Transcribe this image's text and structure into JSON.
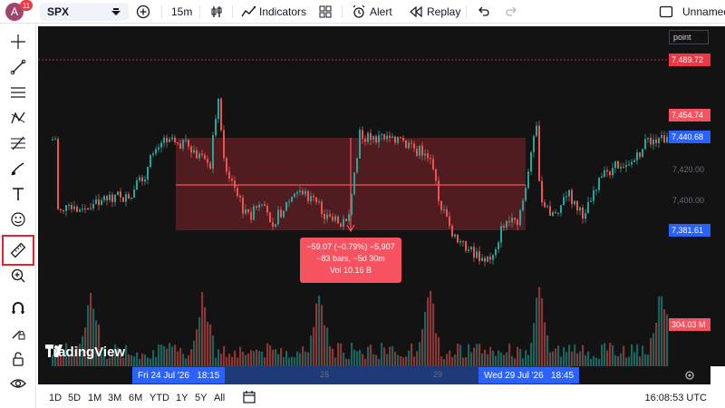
{
  "header": {
    "avatar_letter": "A",
    "notification_count": "11",
    "symbol": "SPX",
    "interval": "15m",
    "indicators_label": "Indicators",
    "alert_label": "Alert",
    "replay_label": "Replay",
    "layout_name": "Unnamed"
  },
  "left_toolbar": {
    "items": [
      "crosshair-icon",
      "trend-line-icon",
      "horizontal-lines-icon",
      "pattern-icon",
      "fib-icon",
      "brush-icon",
      "text-icon",
      "emoji-icon",
      "ruler-icon",
      "zoom-in-icon",
      "magnet-icon",
      "lock-drawing-icon",
      "unlock-icon",
      "eye-icon"
    ],
    "selected": "ruler-icon"
  },
  "chart": {
    "scale_mode": "point",
    "watermark": "TradingView",
    "price_labels": {
      "high": "7,489.72",
      "upper": "7,454.74",
      "current": "7,440.68",
      "lower": "7,381.61",
      "volume": "304.03 M"
    },
    "price_ticks": [
      "7,420.00",
      "7,400.00"
    ],
    "measure": {
      "line1": "−59.07 (−0.79%) −5,907",
      "line2": "−83 bars, −5d 30m",
      "line3": "Vol 10.16 B"
    },
    "time_ticks": [
      "28",
      "29"
    ],
    "time_start": "Fri 24 Jul '26   18:15",
    "time_end": "Wed 29 Jul '26   18:45",
    "colors": {
      "background": "#131313",
      "up": "#26a69a",
      "down": "#ef5350",
      "measure_fill": "rgba(242,54,69,0.28)",
      "measure_popup": "#f7525f",
      "current_price": "#2962ff"
    }
  },
  "bottom_bar": {
    "ranges": [
      "1D",
      "5D",
      "1M",
      "3M",
      "6M",
      "YTD",
      "1Y",
      "5Y",
      "All"
    ],
    "clock": "16:08:53 UTC"
  }
}
